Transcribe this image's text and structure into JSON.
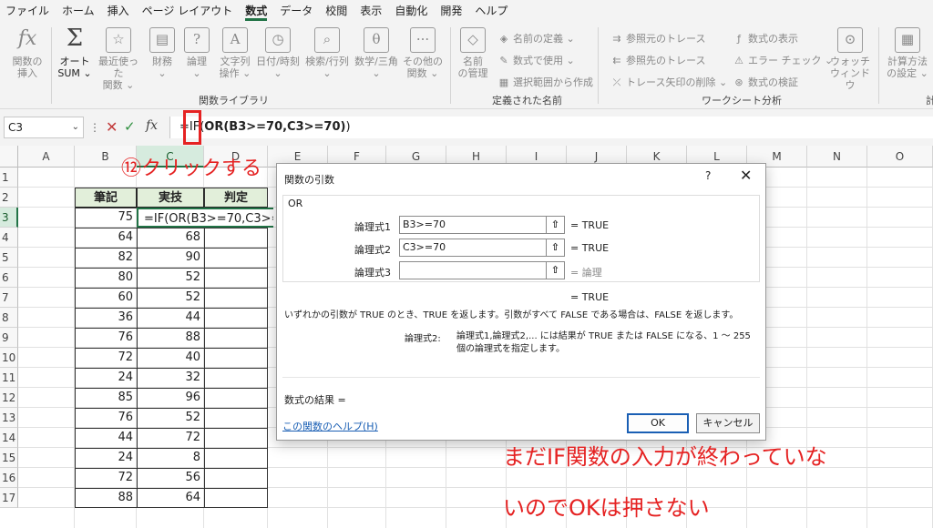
{
  "menu": [
    "ファイル",
    "ホーム",
    "挿入",
    "ページ レイアウト",
    "数式",
    "データ",
    "校閲",
    "表示",
    "自動化",
    "開発",
    "ヘルプ"
  ],
  "ribbon": {
    "insert_function": "関数の\n挿入",
    "autosum": "オート\nSUM ⌄",
    "recent": "最近使った\n関数 ⌄",
    "financial": "財務\n⌄",
    "logical": "論理\n⌄",
    "text": "文字列\n操作 ⌄",
    "datetime": "日付/時刻\n⌄",
    "lookup": "検索/行列\n⌄",
    "math": "数学/三角\n⌄",
    "more": "その他の\n関数 ⌄",
    "group_library": "関数ライブラリ",
    "name_manager": "名前\nの管理",
    "define_name": "名前の定義 ⌄",
    "use_in_formula": "数式で使用 ⌄",
    "create_from_selection": "選択範囲から作成",
    "group_names": "定義された名前",
    "trace_precedents": "参照元のトレース",
    "trace_dependents": "参照先のトレース",
    "remove_arrows": "トレース矢印の削除 ⌄",
    "show_formulas": "数式の表示",
    "error_checking": "エラー チェック ⌄",
    "evaluate_formula": "数式の検証",
    "group_audit": "ワークシート分析",
    "watch_window": "ウォッチ\nウィンドウ",
    "calc_options": "計算方法\nの設定 ⌄",
    "group_calc": "計"
  },
  "formula_bar": {
    "name_box": "C3",
    "formula_prefix": "=IF(",
    "formula_bold": "OR(B3>=70,C3>=70)",
    "formula_suffix": ")"
  },
  "columns": [
    "A",
    "B",
    "C",
    "D",
    "E",
    "F",
    "G",
    "H",
    "I",
    "J",
    "K",
    "L",
    "M",
    "N",
    "O"
  ],
  "rows": [
    "1",
    "2",
    "3",
    "4",
    "5",
    "6",
    "7",
    "8",
    "9",
    "10",
    "11",
    "12",
    "13",
    "14",
    "15",
    "16",
    "17"
  ],
  "table": {
    "headers": [
      "筆記",
      "実技",
      "判定"
    ],
    "rows": [
      [
        "75",
        "",
        ""
      ],
      [
        "64",
        "68",
        ""
      ],
      [
        "82",
        "90",
        ""
      ],
      [
        "80",
        "52",
        ""
      ],
      [
        "60",
        "52",
        ""
      ],
      [
        "36",
        "44",
        ""
      ],
      [
        "76",
        "88",
        ""
      ],
      [
        "72",
        "40",
        ""
      ],
      [
        "24",
        "32",
        ""
      ],
      [
        "85",
        "96",
        ""
      ],
      [
        "76",
        "52",
        ""
      ],
      [
        "44",
        "72",
        ""
      ],
      [
        "24",
        "8",
        ""
      ],
      [
        "72",
        "56",
        ""
      ],
      [
        "88",
        "64",
        ""
      ]
    ],
    "editing_formula": "=IF(OR(B3>=70,C3>=70"
  },
  "dialog": {
    "title": "関数の引数",
    "help": "?",
    "close": "✕",
    "function_name": "OR",
    "args": [
      {
        "label": "論理式1",
        "value": "B3>=70",
        "result": "=  TRUE"
      },
      {
        "label": "論理式2",
        "value": "C3>=70",
        "result": "=  TRUE"
      },
      {
        "label": "論理式3",
        "value": "",
        "result": "=  論理"
      }
    ],
    "overall_result": "=  TRUE",
    "description": "いずれかの引数が TRUE のとき、TRUE を返します。引数がすべて FALSE である場合は、FALSE を返します。",
    "arg_help_label": "論理式2:",
    "arg_help": "論理式1,論理式2,... には結果が TRUE または FALSE になる、1 ～ 255 個の論理式を指定します。",
    "formula_result": "数式の結果 =",
    "help_link": "この関数のヘルプ(H)",
    "ok": "OK",
    "cancel": "キャンセル"
  },
  "annotations": {
    "step": "⑫クリックする",
    "note_line1": "まだIF関数の入力が終わっていな",
    "note_line2": "いのでOKは押さない"
  },
  "colors": {
    "accent": "#217346",
    "annotation": "#e52222",
    "header_fill": "#e2efda",
    "link": "#1a5fb4"
  }
}
